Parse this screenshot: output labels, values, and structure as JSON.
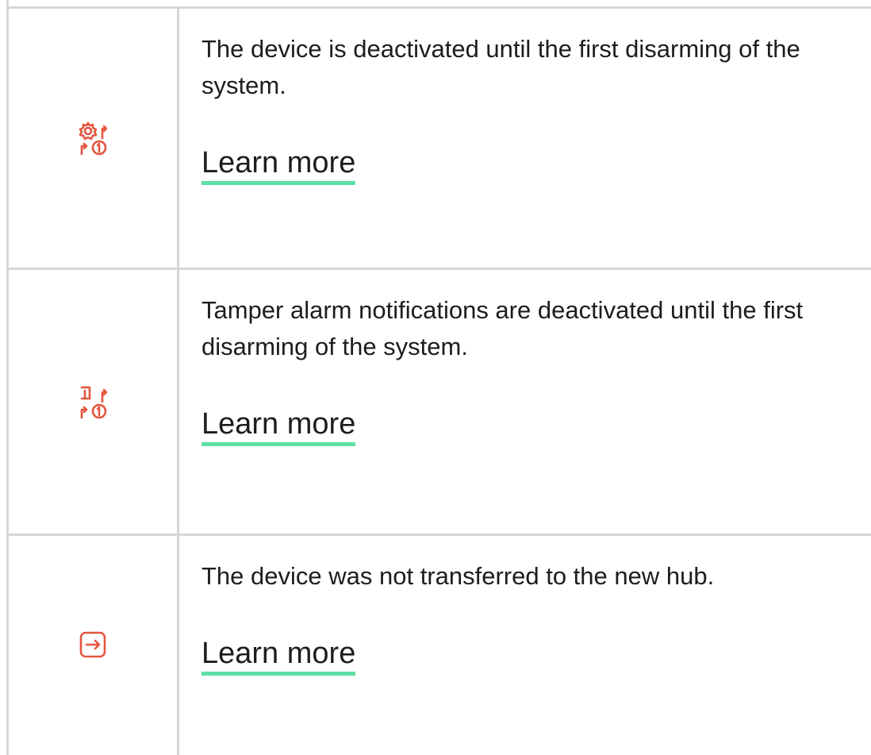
{
  "rows": [
    {
      "icon": "gear-first-disarm-icon",
      "description": "The device is deactivated until the first disarming of the system.",
      "link_label": "Learn more"
    },
    {
      "icon": "tamper-first-disarm-icon",
      "description": "Tamper alarm notifications are deactivated until the first disarming of the system.",
      "link_label": "Learn more"
    },
    {
      "icon": "transfer-arrow-icon",
      "description": "The device was not transferred to the new hub.",
      "link_label": "Learn more"
    }
  ],
  "colors": {
    "icon_red": "#e5553f",
    "link_underline": "#5ee0a4",
    "border": "#d6d6d6",
    "text": "#1d1d1d"
  }
}
